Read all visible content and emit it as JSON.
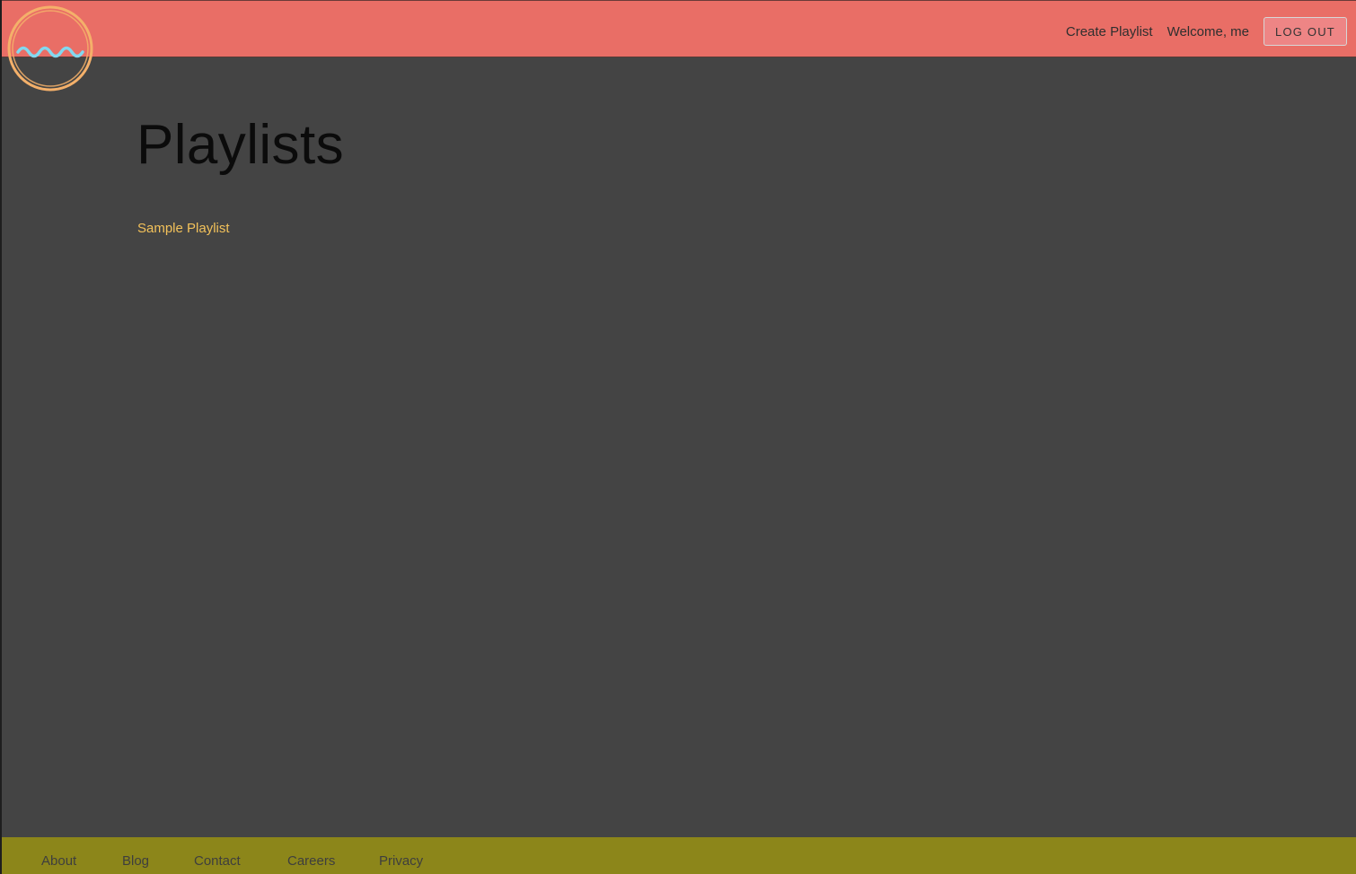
{
  "header": {
    "logo_icon": "wave-circle-icon",
    "nav": {
      "create_playlist": "Create Playlist",
      "welcome": "Welcome, me",
      "logout": "LOG OUT"
    }
  },
  "main": {
    "title": "Playlists",
    "playlists": [
      {
        "name": "Sample Playlist"
      }
    ]
  },
  "footer": {
    "links": [
      "About",
      "Blog",
      "Contact",
      "Careers",
      "Privacy"
    ]
  },
  "colors": {
    "header_bg": "#e96e66",
    "page_bg": "#444444",
    "footer_bg": "#8c861a",
    "link_accent": "#f2c15a",
    "logo_ring": "#f4b06a",
    "logo_wave": "#82d8ef"
  }
}
